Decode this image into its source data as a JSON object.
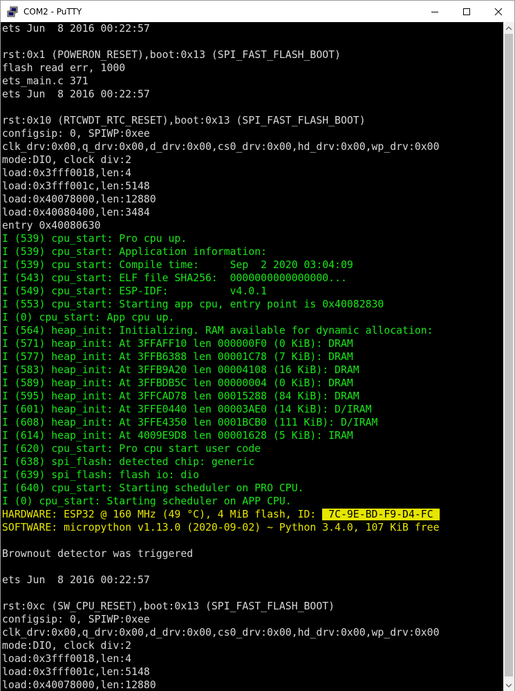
{
  "window": {
    "title": "COM2 - PuTTY",
    "controls": [
      "minimize",
      "maximize",
      "close"
    ]
  },
  "colors": {
    "terminal_bg": "#000000",
    "text_default": "#d8d8d8",
    "text_green": "#19e619",
    "text_yellow": "#e6e600"
  },
  "terminal": {
    "lines": [
      {
        "text": "ets Jun  8 2016 00:22:57",
        "color": "default"
      },
      {
        "text": "",
        "color": "default"
      },
      {
        "text": "rst:0x1 (POWERON_RESET),boot:0x13 (SPI_FAST_FLASH_BOOT)",
        "color": "default"
      },
      {
        "text": "flash read err, 1000",
        "color": "default"
      },
      {
        "text": "ets_main.c 371",
        "color": "default"
      },
      {
        "text": "ets Jun  8 2016 00:22:57",
        "color": "default"
      },
      {
        "text": "",
        "color": "default"
      },
      {
        "text": "rst:0x10 (RTCWDT_RTC_RESET),boot:0x13 (SPI_FAST_FLASH_BOOT)",
        "color": "default"
      },
      {
        "text": "configsip: 0, SPIWP:0xee",
        "color": "default"
      },
      {
        "text": "clk_drv:0x00,q_drv:0x00,d_drv:0x00,cs0_drv:0x00,hd_drv:0x00,wp_drv:0x00",
        "color": "default"
      },
      {
        "text": "mode:DIO, clock div:2",
        "color": "default"
      },
      {
        "text": "load:0x3fff0018,len:4",
        "color": "default"
      },
      {
        "text": "load:0x3fff001c,len:5148",
        "color": "default"
      },
      {
        "text": "load:0x40078000,len:12880",
        "color": "default"
      },
      {
        "text": "load:0x40080400,len:3484",
        "color": "default"
      },
      {
        "text": "entry 0x40080630",
        "color": "default"
      },
      {
        "text": "I (539) cpu_start: Pro cpu up.",
        "color": "green"
      },
      {
        "text": "I (539) cpu_start: Application information:",
        "color": "green"
      },
      {
        "text": "I (539) cpu_start: Compile time:     Sep  2 2020 03:04:09",
        "color": "green"
      },
      {
        "text": "I (543) cpu_start: ELF file SHA256:  0000000000000000...",
        "color": "green"
      },
      {
        "text": "I (549) cpu_start: ESP-IDF:          v4.0.1",
        "color": "green"
      },
      {
        "text": "I (553) cpu_start: Starting app cpu, entry point is 0x40082830",
        "color": "green"
      },
      {
        "text": "I (0) cpu_start: App cpu up.",
        "color": "green"
      },
      {
        "text": "I (564) heap_init: Initializing. RAM available for dynamic allocation:",
        "color": "green"
      },
      {
        "text": "I (571) heap_init: At 3FFAFF10 len 000000F0 (0 KiB): DRAM",
        "color": "green"
      },
      {
        "text": "I (577) heap_init: At 3FFB6388 len 00001C78 (7 KiB): DRAM",
        "color": "green"
      },
      {
        "text": "I (583) heap_init: At 3FFB9A20 len 00004108 (16 KiB): DRAM",
        "color": "green"
      },
      {
        "text": "I (589) heap_init: At 3FFBDB5C len 00000004 (0 KiB): DRAM",
        "color": "green"
      },
      {
        "text": "I (595) heap_init: At 3FFCAD78 len 00015288 (84 KiB): DRAM",
        "color": "green"
      },
      {
        "text": "I (601) heap_init: At 3FFE0440 len 00003AE0 (14 KiB): D/IRAM",
        "color": "green"
      },
      {
        "text": "I (608) heap_init: At 3FFE4350 len 0001BCB0 (111 KiB): D/IRAM",
        "color": "green"
      },
      {
        "text": "I (614) heap_init: At 4009E9D8 len 00001628 (5 KiB): IRAM",
        "color": "green"
      },
      {
        "text": "I (620) cpu_start: Pro cpu start user code",
        "color": "green"
      },
      {
        "text": "I (638) spi_flash: detected chip: generic",
        "color": "green"
      },
      {
        "text": "I (639) spi_flash: flash io: dio",
        "color": "green"
      },
      {
        "text": "I (640) cpu_start: Starting scheduler on PRO CPU.",
        "color": "green"
      },
      {
        "text": "I (0) cpu_start: Starting scheduler on APP CPU.",
        "color": "green"
      },
      {
        "text": "HARDWARE: ESP32 @ 160 MHz (49 °C), 4 MiB flash, ID: ",
        "color": "yellow",
        "highlight": " 7C-9E-BD-F9-D4-FC "
      },
      {
        "text": "SOFTWARE: micropython v1.13.0 (2020-09-02) ~ Python 3.4.0, 107 KiB free",
        "color": "yellow"
      },
      {
        "text": "",
        "color": "default"
      },
      {
        "text": "Brownout detector was triggered",
        "color": "default"
      },
      {
        "text": "",
        "color": "default"
      },
      {
        "text": "ets Jun  8 2016 00:22:57",
        "color": "default"
      },
      {
        "text": "",
        "color": "default"
      },
      {
        "text": "rst:0xc (SW_CPU_RESET),boot:0x13 (SPI_FAST_FLASH_BOOT)",
        "color": "default"
      },
      {
        "text": "configsip: 0, SPIWP:0xee",
        "color": "default"
      },
      {
        "text": "clk_drv:0x00,q_drv:0x00,d_drv:0x00,cs0_drv:0x00,hd_drv:0x00,wp_drv:0x00",
        "color": "default"
      },
      {
        "text": "mode:DIO, clock div:2",
        "color": "default"
      },
      {
        "text": "load:0x3fff0018,len:4",
        "color": "default"
      },
      {
        "text": "load:0x3fff001c,len:5148",
        "color": "default"
      },
      {
        "text": "load:0x40078000,len:12880",
        "color": "default"
      }
    ]
  }
}
